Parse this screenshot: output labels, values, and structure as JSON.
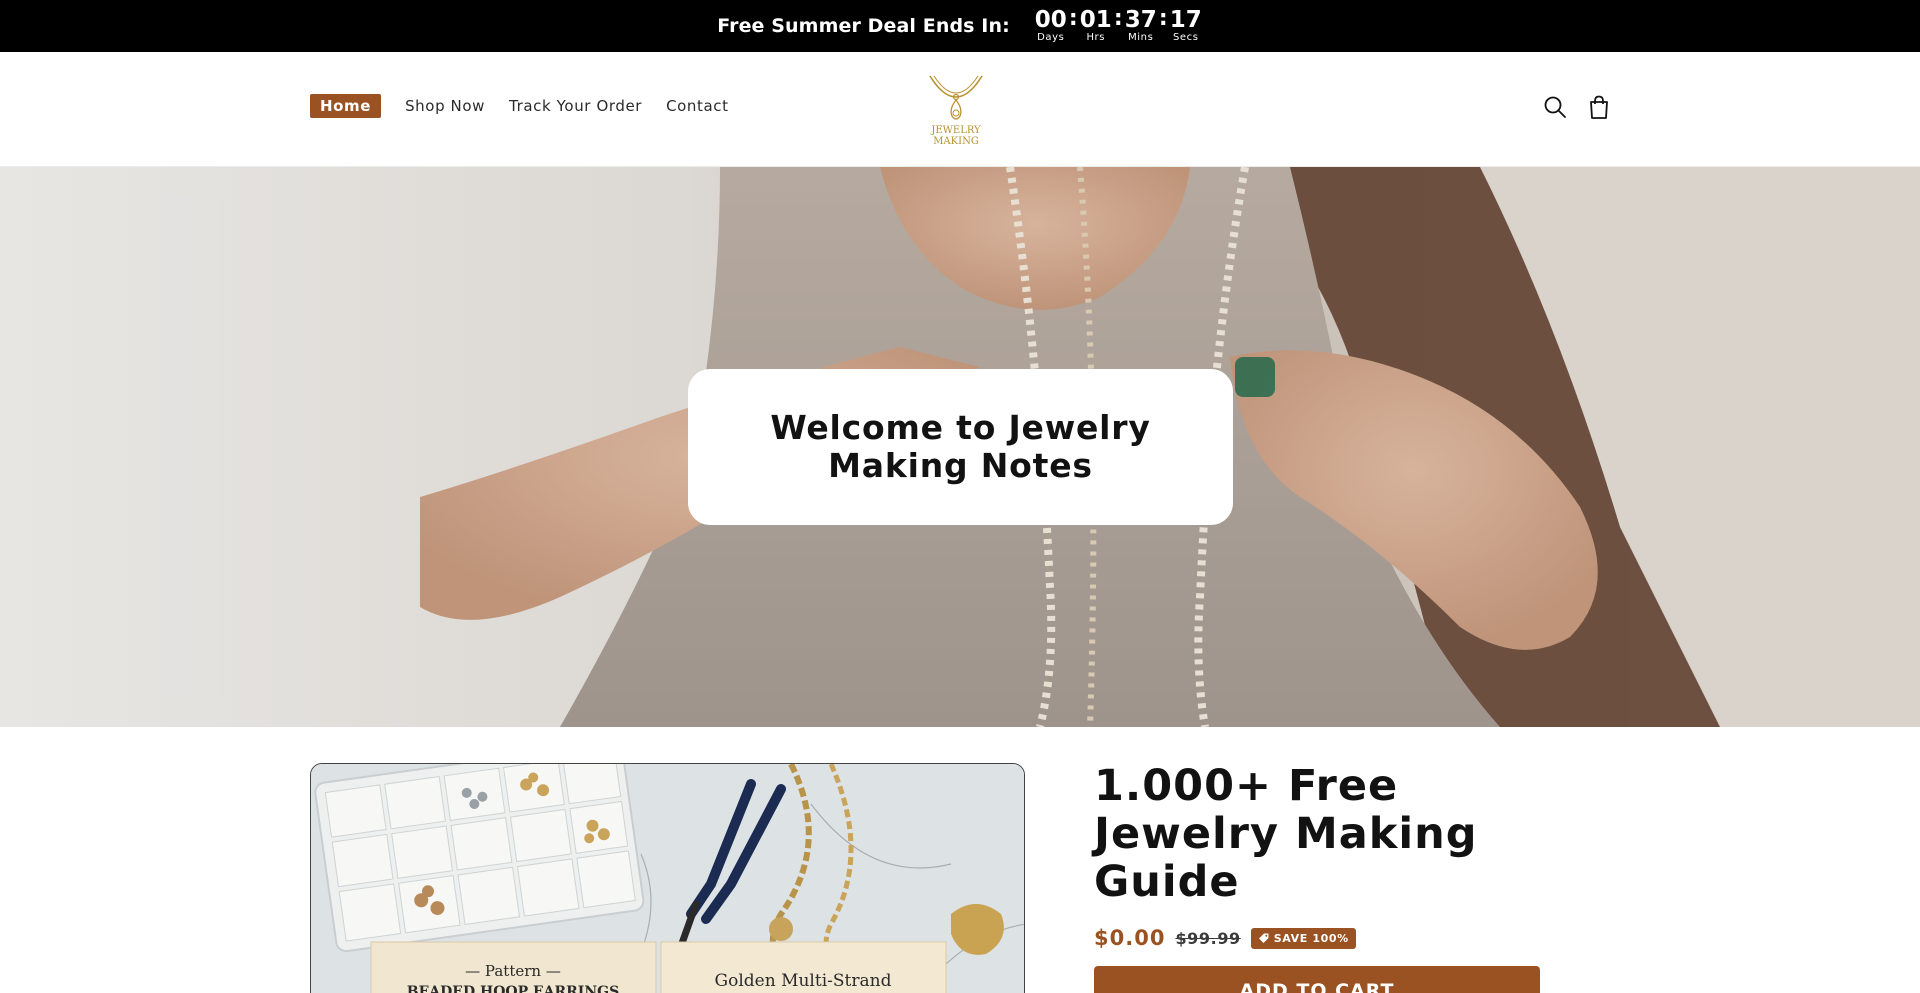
{
  "announcement": {
    "text": "Free Summer Deal Ends In:",
    "countdown": [
      {
        "value": "00",
        "label": "Days"
      },
      {
        "value": "01",
        "label": "Hrs"
      },
      {
        "value": "37",
        "label": "Mins"
      },
      {
        "value": "17",
        "label": "Secs"
      }
    ],
    "separator": ":"
  },
  "header": {
    "nav": [
      {
        "label": "Home",
        "active": true
      },
      {
        "label": "Shop Now"
      },
      {
        "label": "Track Your Order"
      },
      {
        "label": "Contact"
      }
    ],
    "logo": {
      "line1": "JEWELRY",
      "line2": "MAKING",
      "color": "#b8922f"
    },
    "icons": [
      "search-icon",
      "cart-icon"
    ]
  },
  "hero": {
    "title": "Welcome to Jewelry Making Notes"
  },
  "product": {
    "image_text": {
      "pattern_label": "— Pattern —",
      "card_left": "BEADED HOOP EARRINGS",
      "card_right": "Golden Multi-Strand"
    },
    "title": "1.000+ Free Jewelry Making Guide",
    "price": "$0.00",
    "compare_price": "$99.99",
    "badge": "SAVE 100%",
    "add_to_cart": "ADD TO CART"
  },
  "colors": {
    "accent": "#9a5222",
    "announcement_bg": "#000000",
    "logo_gold": "#b8922f"
  }
}
